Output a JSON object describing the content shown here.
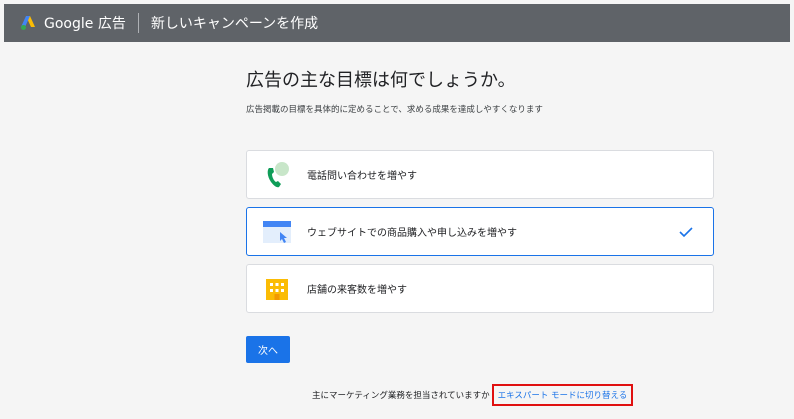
{
  "header": {
    "brand": "Google 広告",
    "page_title": "新しいキャンペーンを作成"
  },
  "main": {
    "heading": "広告の主な目標は何でしょうか。",
    "subheading": "広告掲載の目標を具体的に定めることで、求める成果を達成しやすくなります",
    "options": [
      {
        "label": "電話問い合わせを増やす",
        "icon": "phone-icon",
        "selected": false
      },
      {
        "label": "ウェブサイトでの商品購入や申し込みを増やす",
        "icon": "website-icon",
        "selected": true
      },
      {
        "label": "店舗の来客数を増やす",
        "icon": "store-icon",
        "selected": false
      }
    ],
    "next_label": "次へ"
  },
  "footer": {
    "question": "主にマーケティング業務を担当されていますか",
    "expert_link": "エキスパート モードに切り替える"
  },
  "colors": {
    "header_bg": "#5f6368",
    "accent": "#1a73e8",
    "highlight_border": "#e01010"
  }
}
